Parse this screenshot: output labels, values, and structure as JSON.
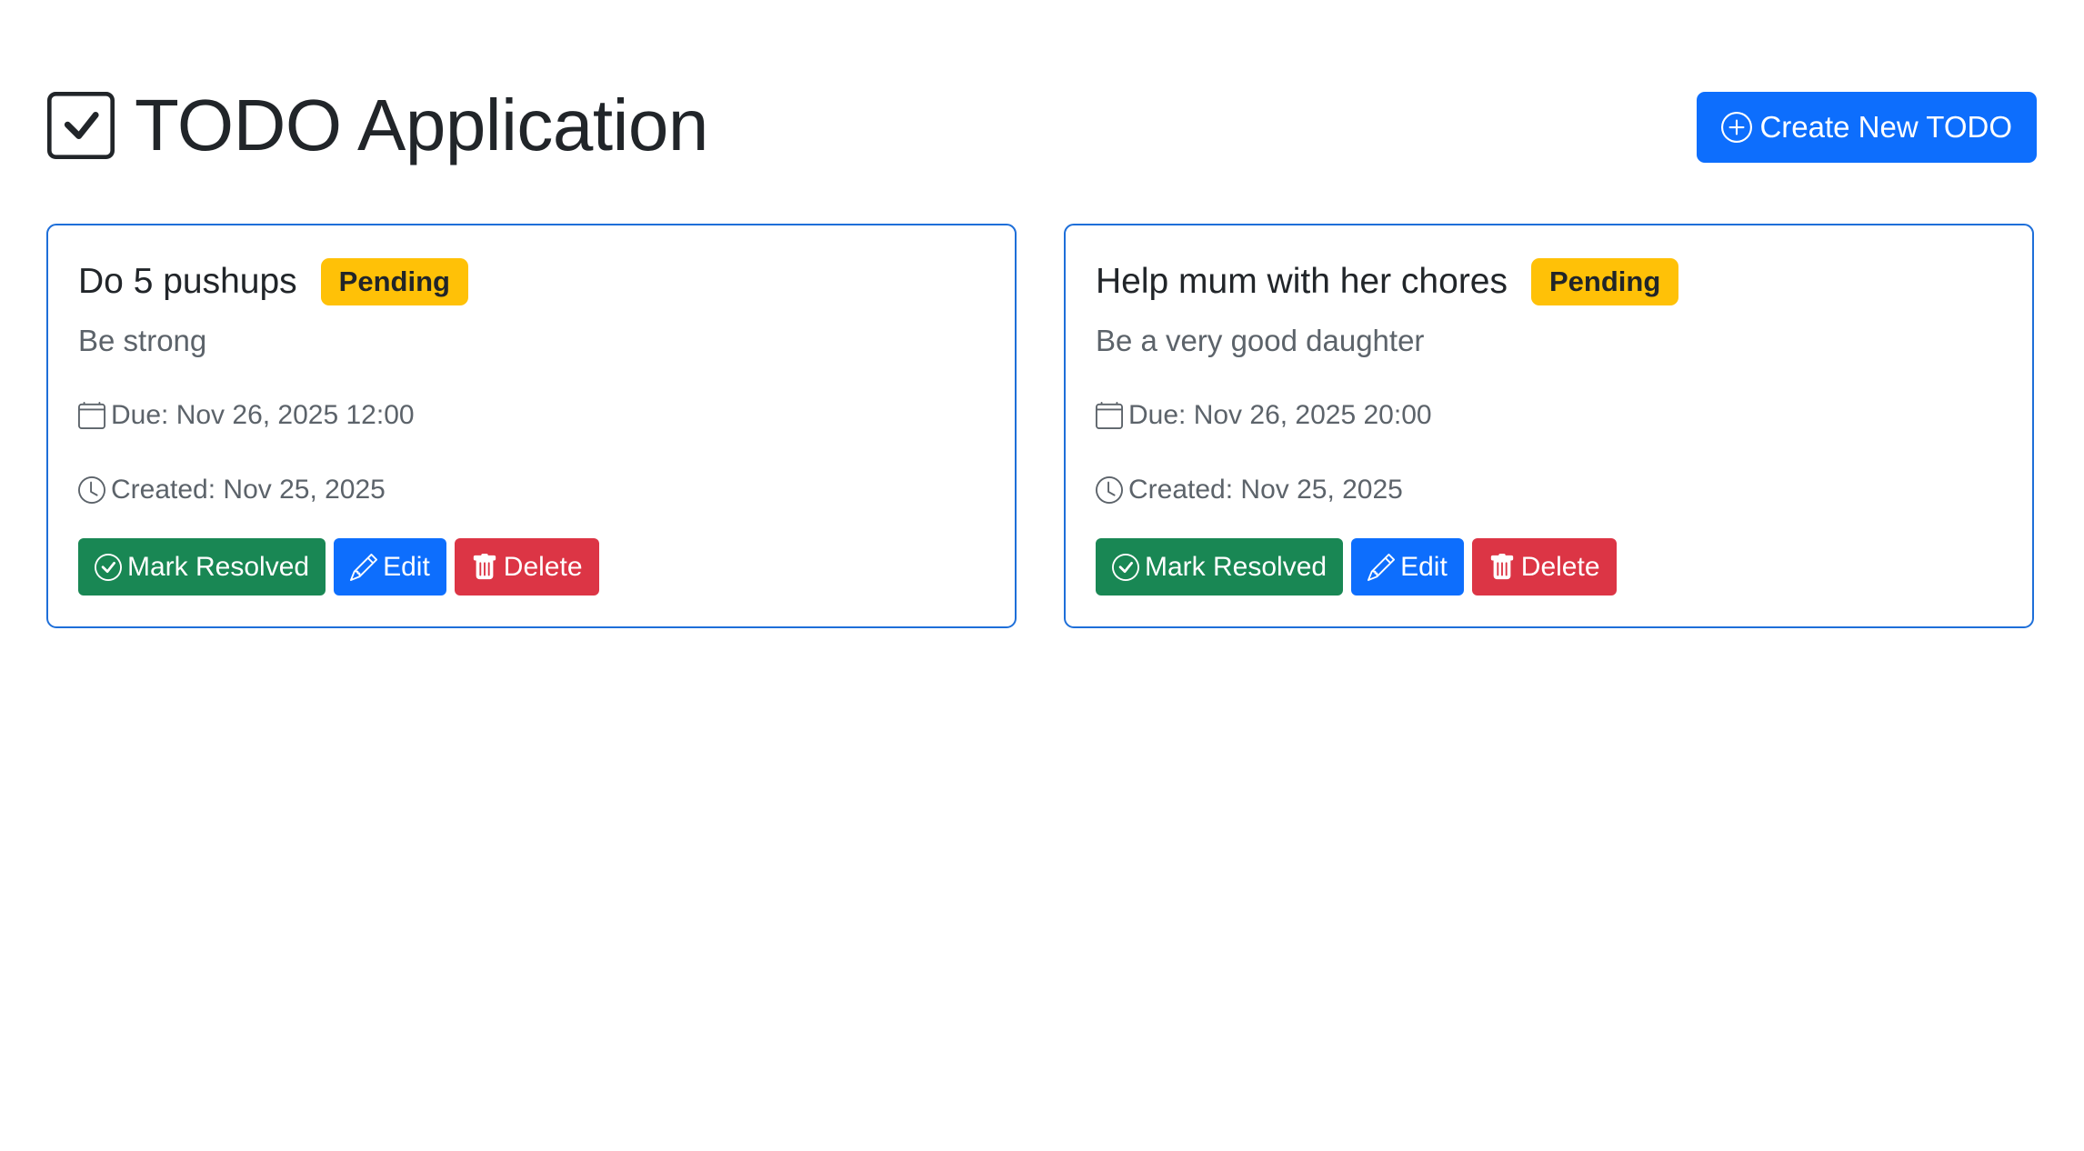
{
  "header": {
    "title": "TODO Application",
    "title_icon": "check-square-icon",
    "create_label": "Create New TODO",
    "create_icon": "plus-circle-icon"
  },
  "colors": {
    "primary": "#0d6efd",
    "success": "#198754",
    "danger": "#dc3545",
    "warning": "#ffc107",
    "card_border": "#1e6fd9"
  },
  "todos": [
    {
      "title": "Do 5 pushups",
      "status": "Pending",
      "description": "Be strong",
      "due": "Due: Nov 26, 2025 12:00",
      "created": "Created: Nov 25, 2025",
      "actions": {
        "resolve": "Mark Resolved",
        "edit": "Edit",
        "delete": "Delete"
      }
    },
    {
      "title": "Help mum with her chores",
      "status": "Pending",
      "description": "Be a very good daughter",
      "due": "Due: Nov 26, 2025 20:00",
      "created": "Created: Nov 25, 2025",
      "actions": {
        "resolve": "Mark Resolved",
        "edit": "Edit",
        "delete": "Delete"
      }
    }
  ]
}
